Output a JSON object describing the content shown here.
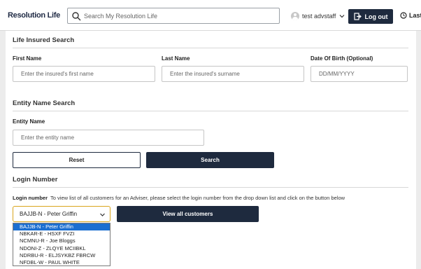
{
  "header": {
    "logo": "Resolution Life",
    "search_placeholder": "Search My Resolution Life",
    "user_name": "test advstaff",
    "logout_label": "Log out",
    "last_label": "Last"
  },
  "life_insured": {
    "title": "Life Insured Search",
    "first_name_label": "First Name",
    "first_name_placeholder": "Enter the insured's first name",
    "last_name_label": "Last Name",
    "last_name_placeholder": "Enter the insured's surname",
    "dob_label": "Date Of Birth (Optional)",
    "dob_placeholder": "DD/MM/YYYY"
  },
  "entity": {
    "title": "Entity Name Search",
    "name_label": "Entity Name",
    "name_placeholder": "Enter the entity name"
  },
  "actions": {
    "reset_label": "Reset",
    "search_label": "Search"
  },
  "login": {
    "title": "Login Number",
    "label": "Login number",
    "help": "To view list of all customers for an Adviser, please select the login number from the drop down list and click on the button below",
    "selected": "BAJJB-N - Peter Griffin",
    "view_all_label": "View all customers",
    "options": [
      "BAJJB-N - Peter Griffin",
      "NBKAR-E - HSXF FVZI",
      "NCMNU-R - Joe Bloggs",
      "NDONI-Z - ZLQYE MCIIBKL",
      "NDRBU-R - ELJSYKBZ FBRCW",
      "NFDBL-W - PAUL WHITE"
    ]
  },
  "colors": {
    "primary": "#1e2a3e",
    "select_focus": "#d9a51c",
    "option_highlight": "#1c6fd1",
    "background": "#ececec"
  }
}
